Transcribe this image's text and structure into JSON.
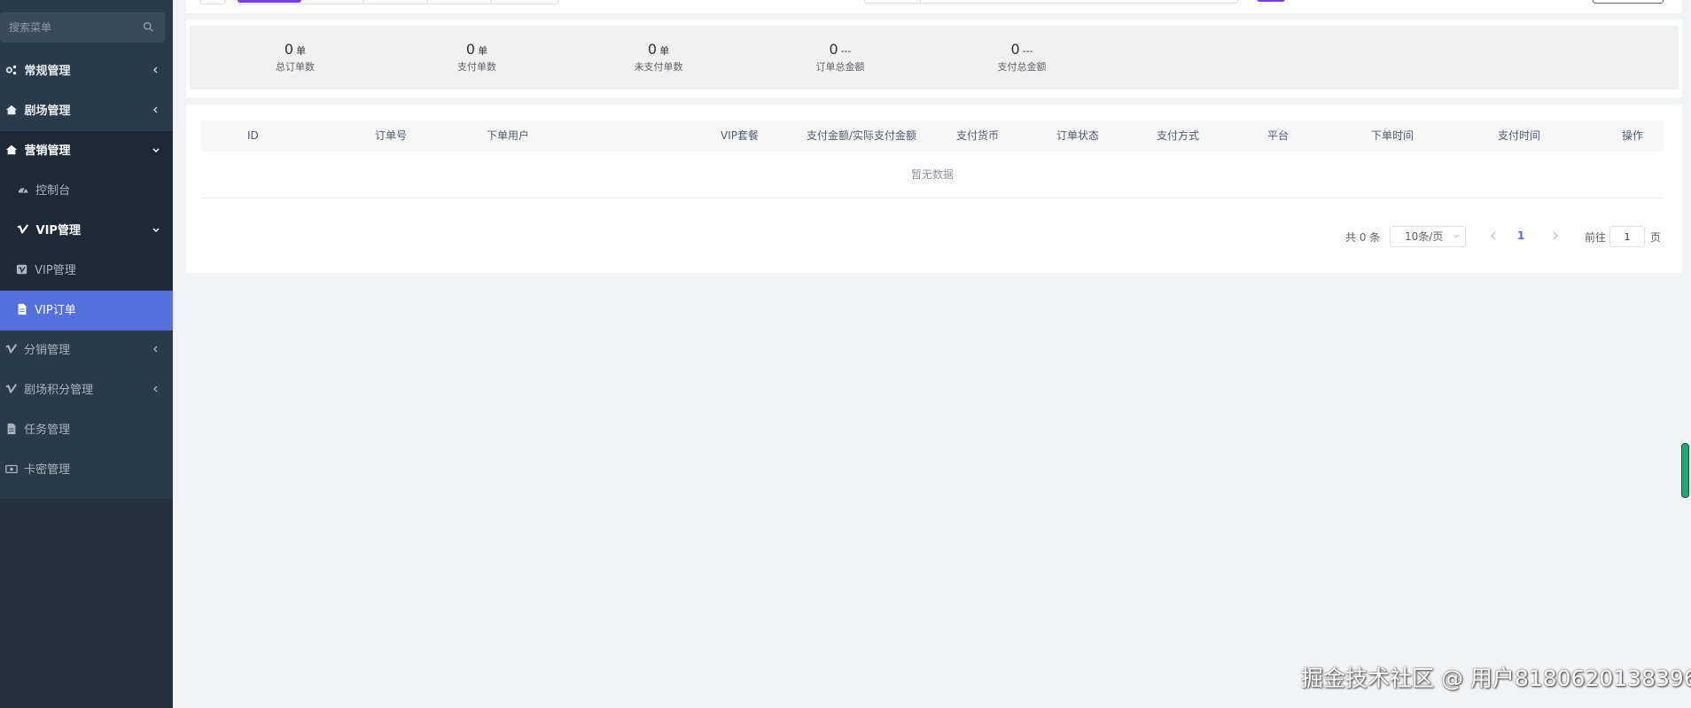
{
  "sidebar": {
    "search_placeholder": "搜索菜单",
    "items": [
      {
        "label": "常规管理",
        "icon": "cogs-icon"
      },
      {
        "label": "剧场管理",
        "icon": "home-icon"
      },
      {
        "label": "营销管理",
        "icon": "home-icon"
      },
      {
        "label": "控制台",
        "icon": "dashboard-icon"
      },
      {
        "label": "VIP管理",
        "icon": "vimeo-icon"
      },
      {
        "label": "VIP管理",
        "icon": "vimeo-square-icon"
      },
      {
        "label": "VIP订单",
        "icon": "file-icon"
      },
      {
        "label": "分销管理",
        "icon": "vimeo-icon"
      },
      {
        "label": "剧场积分管理",
        "icon": "vimeo-icon"
      },
      {
        "label": "任务管理",
        "icon": "file-icon"
      },
      {
        "label": "卡密管理",
        "icon": "money-icon"
      }
    ]
  },
  "stats": [
    {
      "value": "0",
      "unit": "单",
      "label": "总订单数"
    },
    {
      "value": "0",
      "unit": "单",
      "label": "支付单数"
    },
    {
      "value": "0",
      "unit": "单",
      "label": "未支付单数"
    },
    {
      "value": "0",
      "unit": "---",
      "label": "订单总金额"
    },
    {
      "value": "0",
      "unit": "---",
      "label": "支付总金额"
    }
  ],
  "table": {
    "columns": [
      "ID",
      "订单号",
      "下单用户",
      "VIP套餐",
      "支付金额/实际支付金额",
      "支付货币",
      "订单状态",
      "支付方式",
      "平台",
      "下单时间",
      "支付时间",
      "操作"
    ],
    "empty_text": "暂无数据"
  },
  "pagination": {
    "total": "共 0 条",
    "page_size": "10条/页",
    "current_page": "1",
    "goto_label": "前往",
    "goto_value": "1",
    "page_suffix": "页"
  },
  "watermark": "掘金技术社区 @ 用户8180620138396",
  "colors": {
    "sidebar_bg": "#2a3a48",
    "sidebar_active": "#5470dc",
    "accent_purple": "#7b3ff2"
  }
}
